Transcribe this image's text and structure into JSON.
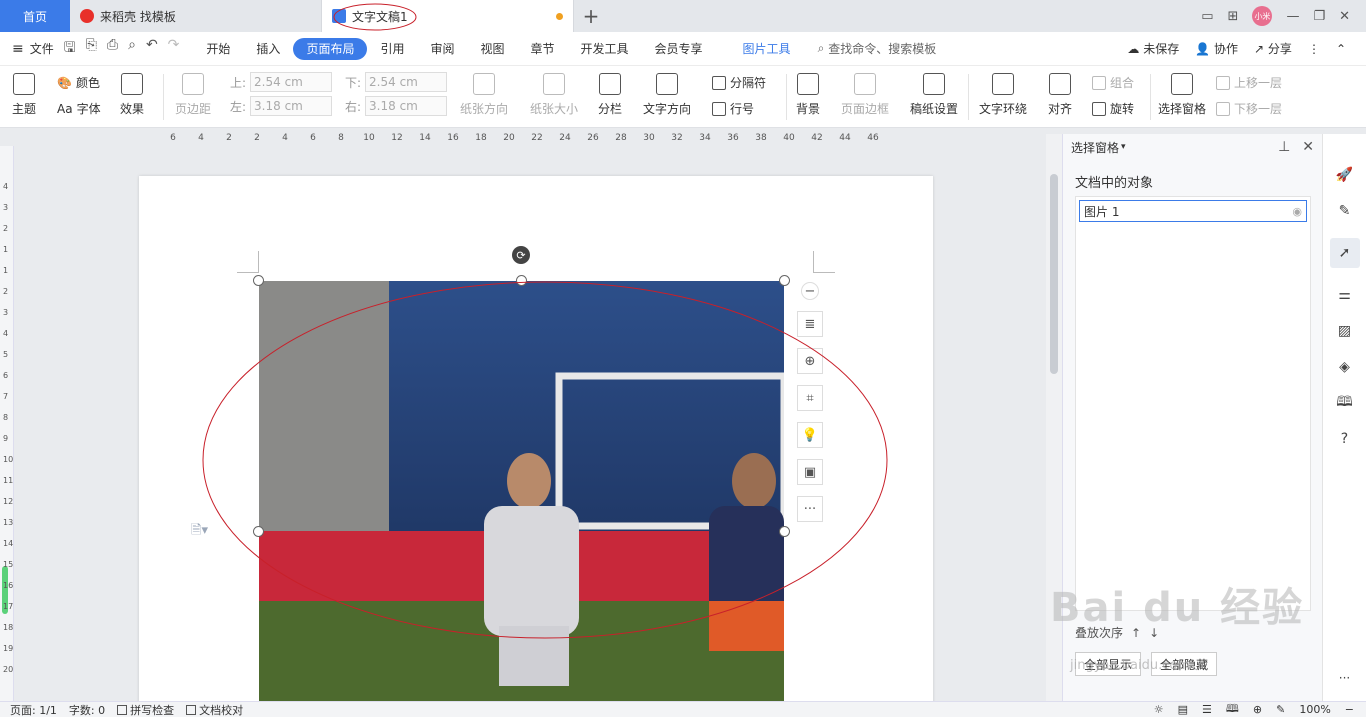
{
  "tabs": {
    "home": "首页",
    "template": "来稻壳 找模板",
    "doc": "文字文稿1",
    "new_tab": "+"
  },
  "window": {
    "avatar": "小米"
  },
  "menubar": {
    "file": "文件",
    "items": [
      "开始",
      "插入",
      "页面布局",
      "引用",
      "审阅",
      "视图",
      "章节",
      "开发工具",
      "会员专享"
    ],
    "active": "页面布局",
    "context_tab": "图片工具",
    "search": "查找命令、搜索模板",
    "unsaved": "未保存",
    "collab": "协作",
    "share": "分享"
  },
  "ribbon": {
    "theme": "主题",
    "color": "颜色",
    "font": "字体",
    "effect": "效果",
    "margins": "页边距",
    "margin_top_label": "上:",
    "margin_top_value": "2.54 cm",
    "margin_bottom_label": "下:",
    "margin_bottom_value": "2.54 cm",
    "margin_left_label": "左:",
    "margin_left_value": "3.18 cm",
    "margin_right_label": "右:",
    "margin_right_value": "3.18 cm",
    "orientation": "纸张方向",
    "size": "纸张大小",
    "columns": "分栏",
    "text_direction": "文字方向",
    "breaks": "分隔符",
    "line_numbers": "行号",
    "background": "背景",
    "page_border": "页面边框",
    "grid_paper": "稿纸设置",
    "wrap_text": "文字环绕",
    "align": "对齐",
    "group": "组合",
    "rotate": "旋转",
    "selection_pane": "选择窗格",
    "bring_forward": "上移一层",
    "send_backward": "下移一层"
  },
  "ruler": {
    "h_ticks": [
      "6",
      "4",
      "2",
      "2",
      "4",
      "6",
      "8",
      "10",
      "12",
      "14",
      "16",
      "18",
      "20",
      "22",
      "24",
      "26",
      "28",
      "30",
      "32",
      "34",
      "36",
      "38",
      "40",
      "42",
      "44",
      "46"
    ],
    "v_ticks": [
      "4",
      "3",
      "2",
      "1",
      "1",
      "2",
      "3",
      "4",
      "5",
      "6",
      "7",
      "8",
      "9",
      "10",
      "11",
      "12",
      "13",
      "14",
      "15",
      "16",
      "17",
      "18",
      "19",
      "20"
    ]
  },
  "pane": {
    "title": "选择窗格",
    "subtitle": "文档中的对象",
    "items": [
      "图片 1"
    ],
    "order_label": "叠放次序",
    "show_all": "全部显示",
    "hide_all": "全部隐藏"
  },
  "status": {
    "page": "页面: 1/1",
    "words": "字数: 0",
    "spell": "拼写检查",
    "proof": "文档校对",
    "zoom": "100%"
  },
  "watermark": {
    "brand": "Bai du 经验",
    "url": "jingyan.baidu.com"
  },
  "colors": {
    "accent": "#3b7be8",
    "annotation": "#c8202a"
  }
}
